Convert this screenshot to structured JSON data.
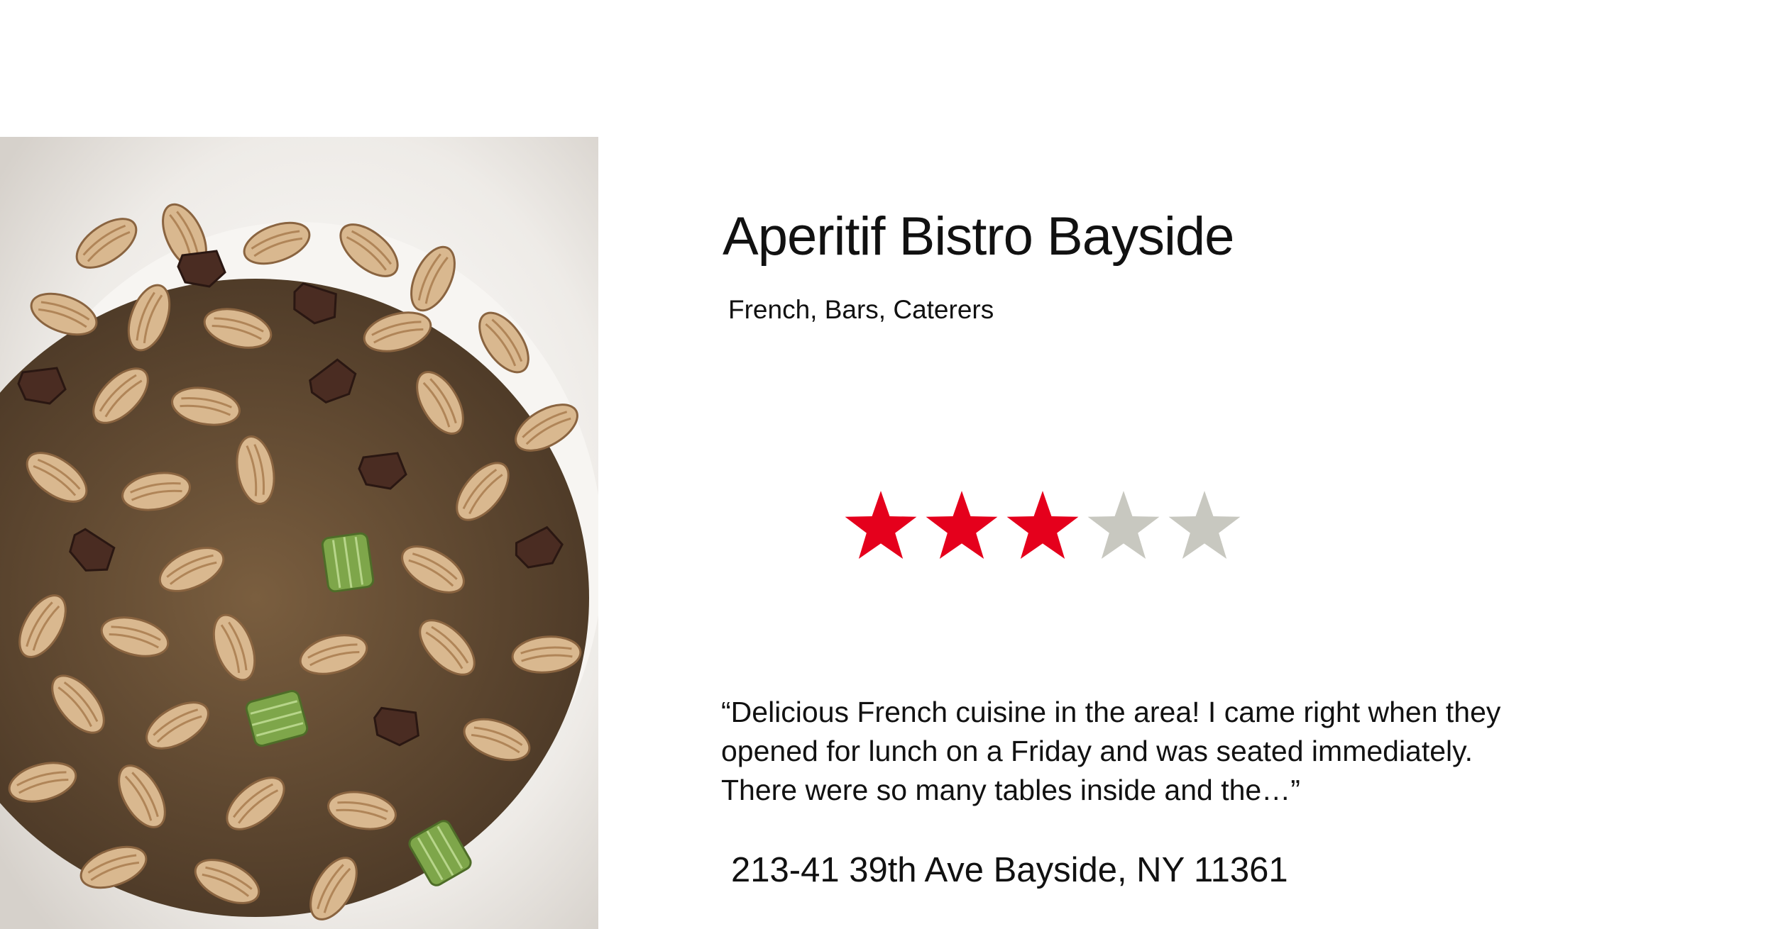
{
  "listing": {
    "name": "Aperitif Bistro Bayside",
    "categories": "French, Bars, Caterers",
    "rating": 3,
    "rating_max": 5,
    "review": "“Delicious French cuisine in the area! I came right when they\n opened for lunch on a Friday and was seated immediately.\nThere were so many tables inside and the…”",
    "address": "213-41 39th Ave Bayside, NY 11361"
  },
  "colors": {
    "star_filled": "#e5001c",
    "star_empty": "#c8c8c0"
  }
}
